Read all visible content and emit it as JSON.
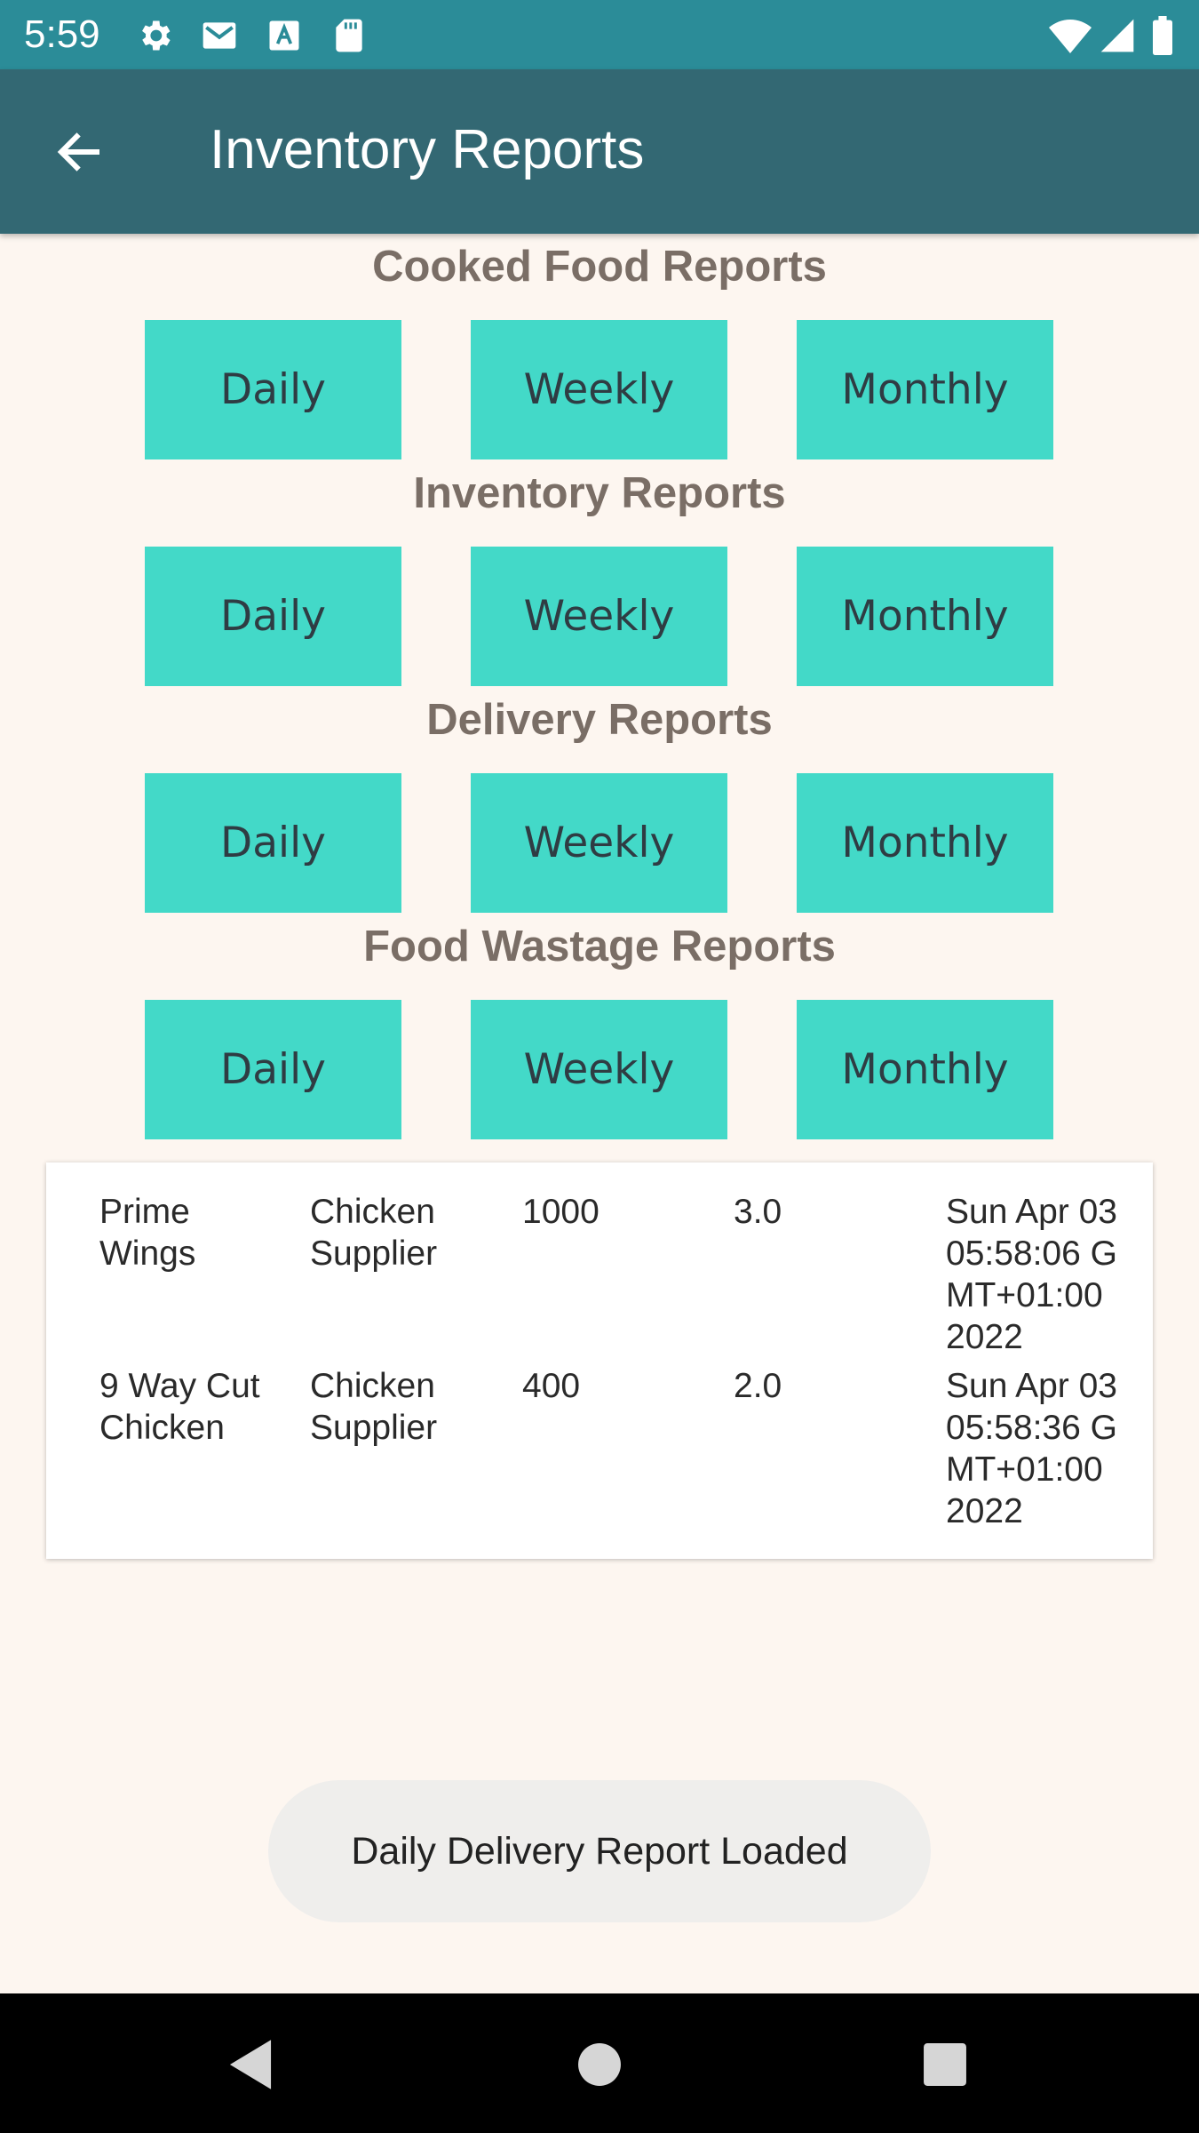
{
  "status_bar": {
    "time": "5:59",
    "left_icons": [
      "gear-icon",
      "gmail-icon",
      "font-a-icon",
      "sd-card-icon"
    ],
    "right_icons": [
      "wifi-icon",
      "signal-icon",
      "battery-icon"
    ]
  },
  "app_bar": {
    "title": "Inventory Reports",
    "back_icon": "arrow-left-icon"
  },
  "sections": [
    {
      "title": "Cooked Food Reports",
      "buttons": [
        "Daily",
        "Weekly",
        "Monthly"
      ]
    },
    {
      "title": "Inventory Reports",
      "buttons": [
        "Daily",
        "Weekly",
        "Monthly"
      ]
    },
    {
      "title": "Delivery Reports",
      "buttons": [
        "Daily",
        "Weekly",
        "Monthly"
      ]
    },
    {
      "title": "Food Wastage Reports",
      "buttons": [
        "Daily",
        "Weekly",
        "Monthly"
      ]
    }
  ],
  "report": {
    "rows": [
      {
        "item": "Prime\nWings",
        "supplier": "Chicken\nSupplier",
        "quantity": "1000",
        "price": "3.0",
        "date": "Sun Apr 03\n05:58:06 G\nMT+01:00\n2022"
      },
      {
        "item": "9 Way Cut\nChicken",
        "supplier": "Chicken\nSupplier",
        "quantity": "400",
        "price": "2.0",
        "date": "Sun Apr 03\n05:58:36 G\nMT+01:00\n2022"
      }
    ]
  },
  "toast": {
    "message": "Daily Delivery Report Loaded"
  },
  "nav_bar": {
    "icons": [
      "back-triangle-icon",
      "home-circle-icon",
      "recents-square-icon"
    ]
  },
  "colors": {
    "status_bar": "#2b8c98",
    "app_bar": "#336873",
    "button": "#43d9c8",
    "background": "#fdf6f0",
    "section_title": "#7a6e66"
  }
}
